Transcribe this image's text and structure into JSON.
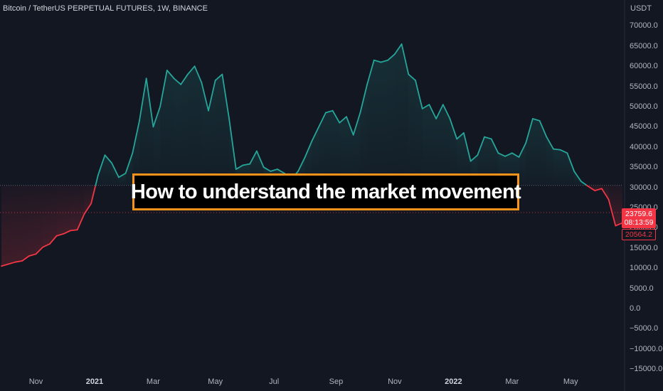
{
  "header": {
    "symbol_title": "Bitcoin / TetherUS PERPETUAL FUTURES, 1W, BINANCE",
    "currency": "USDT"
  },
  "banner": {
    "text": "How to understand the market movement"
  },
  "colors": {
    "background": "#131722",
    "up": "#26a69a",
    "down": "#f23645",
    "banner_border": "#f7931a"
  },
  "price_badge": {
    "price": "23759.6",
    "countdown": "08:13:59"
  },
  "low_badge": {
    "price": "20564.2"
  },
  "chart_data": {
    "type": "area",
    "title": "Bitcoin / TetherUS PERPETUAL FUTURES, 1W, BINANCE",
    "xlabel": "",
    "ylabel": "USDT",
    "ylim": [
      -15000,
      72000
    ],
    "baseline": 30500,
    "grid": false,
    "x_ticks": [
      {
        "label": "Nov",
        "week": 5,
        "year": false
      },
      {
        "label": "2021",
        "week": 13.5,
        "year": true
      },
      {
        "label": "Mar",
        "week": 22,
        "year": false
      },
      {
        "label": "May",
        "week": 31,
        "year": false
      },
      {
        "label": "Jul",
        "week": 39.5,
        "year": false
      },
      {
        "label": "Sep",
        "week": 48.5,
        "year": false
      },
      {
        "label": "Nov",
        "week": 57,
        "year": false
      },
      {
        "label": "2022",
        "week": 65.5,
        "year": true
      },
      {
        "label": "Mar",
        "week": 74,
        "year": false
      },
      {
        "label": "May",
        "week": 82.5,
        "year": false
      }
    ],
    "y_ticks": [
      70000,
      65000,
      60000,
      55000,
      50000,
      45000,
      40000,
      35000,
      30000,
      25000,
      20000,
      15000,
      10000,
      5000,
      0,
      -5000,
      -10000,
      -15000
    ],
    "y_tick_labels": [
      "70000.0",
      "65000.0",
      "60000.0",
      "55000.0",
      "50000.0",
      "45000.0",
      "40000.0",
      "35000.0",
      "30000.0",
      "25000.0",
      "20000.0",
      "15000.0",
      "10000.0",
      "5000.0",
      "0.0",
      "−5000.0",
      "−10000.0",
      "−15000.0"
    ],
    "last_price": 23759.6,
    "low_price": 20564.2,
    "series": [
      {
        "values": [
          10500,
          11000,
          11500,
          11800,
          13000,
          13500,
          15200,
          16000,
          18000,
          18500,
          19300,
          19500,
          23400,
          26000,
          33000,
          38000,
          36000,
          32500,
          33500,
          38500,
          46500,
          57000,
          45000,
          50000,
          59000,
          57000,
          55500,
          58000,
          60000,
          56000,
          49000,
          56500,
          58000,
          47000,
          34500,
          35500,
          35800,
          39000,
          35000,
          34000,
          34500,
          33500,
          32000,
          34000,
          37500,
          41500,
          45000,
          48500,
          49000,
          46000,
          47500,
          43000,
          48500,
          55500,
          61500,
          61000,
          61500,
          63000,
          65500,
          58000,
          56500,
          49500,
          50500,
          47000,
          50500,
          47000,
          42000,
          43500,
          36500,
          38000,
          42500,
          42000,
          38500,
          37700,
          38500,
          37500,
          41000,
          47000,
          46500,
          42500,
          39500,
          39300,
          38500,
          34000,
          31500,
          30300,
          29200,
          29700,
          27000,
          20500,
          21200
        ]
      }
    ]
  }
}
